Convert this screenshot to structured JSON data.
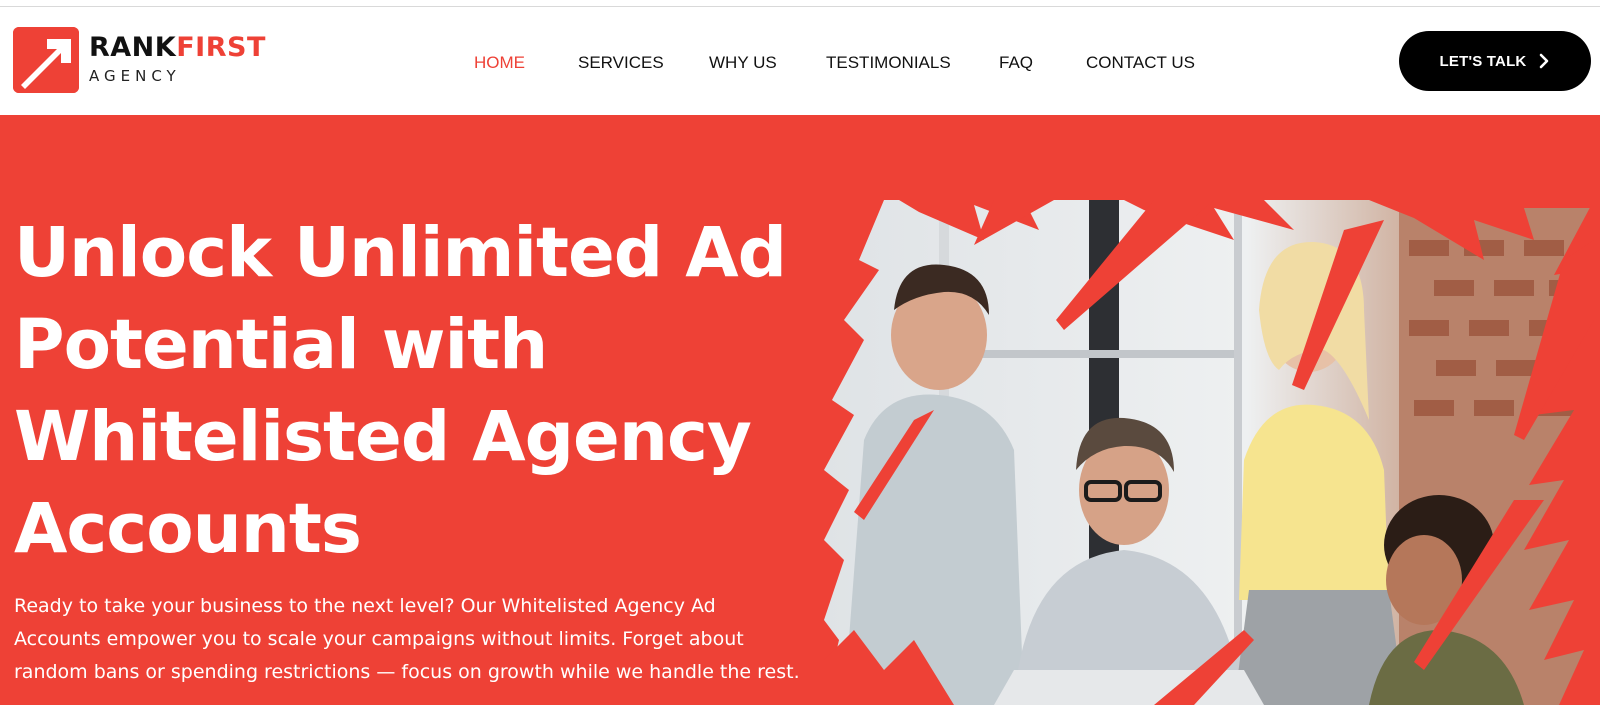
{
  "logo": {
    "word_rank": "RANK",
    "word_first": "FIRST",
    "subtitle": "AGENCY",
    "icon": "arrow-up-right-icon"
  },
  "nav": {
    "items": [
      {
        "label": "HOME",
        "active": true
      },
      {
        "label": "SERVICES",
        "active": false
      },
      {
        "label": "WHY US",
        "active": false
      },
      {
        "label": "TESTIMONIALS",
        "active": false
      },
      {
        "label": "FAQ",
        "active": false
      },
      {
        "label": "CONTACT US",
        "active": false
      }
    ]
  },
  "cta": {
    "label": "LET'S TALK",
    "icon": "chevron-right-icon"
  },
  "hero": {
    "title": "Unlock Unlimited Ad Potential with Whitelisted Agency Accounts",
    "text": "Ready to take your business to the next level? Our Whitelisted Agency Ad Accounts empower you to scale your campaigns without limits. Forget about random bans or spending restrictions — focus on growth while we handle the rest."
  },
  "colors": {
    "brand_red": "#ee4136",
    "dark": "#000000",
    "white": "#ffffff"
  }
}
